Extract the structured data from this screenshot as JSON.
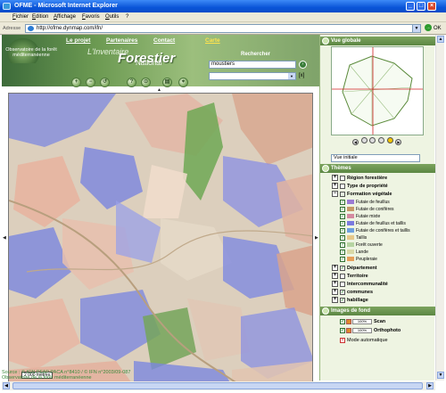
{
  "window": {
    "title": "OFME - Microsoft Internet Explorer"
  },
  "menu": [
    "Fichier",
    "Edition",
    "Affichage",
    "Favoris",
    "Outils",
    "?"
  ],
  "address": {
    "label": "Adresse",
    "url": "http://ofme.dynmap.com/ifn/",
    "go": "OK"
  },
  "site": {
    "logo_text": "Observatoire de la forêt méditerranéenne",
    "nav": [
      "Le projet",
      "Partenaires",
      "Contact",
      "Carte"
    ],
    "brand_small": "L'Inventaire",
    "brand_big": "Forestier",
    "brand_sub": "National",
    "search_label": "Rechercher",
    "search_value": "moustiers",
    "search_clear": "[x]"
  },
  "map": {
    "scale_text": "2 000   mètres",
    "source_line1": "Source : © IGN PFAP PACA n°8410 / © IFN n°2003/09-087",
    "source_line2": "Observatoire de la forêt méditerranéenne"
  },
  "panel": {
    "vue_globale": "Vue globale",
    "vue_select": "Vue initiale",
    "themes_title": "Thèmes",
    "themes": [
      "Région forestière",
      "Type de propriété",
      "Formation végétale"
    ],
    "formation": [
      {
        "label": "Futaie de feuillus",
        "color": "#9b7bd4"
      },
      {
        "label": "Futaie de conifères",
        "color": "#c79a6a"
      },
      {
        "label": "Futaie mixte",
        "color": "#d58aa0"
      },
      {
        "label": "Futaie de feuillus et taillis",
        "color": "#7a7adf"
      },
      {
        "label": "Futaie de conifères et taillis",
        "color": "#6ea0df"
      },
      {
        "label": "Taillis",
        "color": "#e6c88a"
      },
      {
        "label": "Forêt ouverte",
        "color": "#b6d4a2"
      },
      {
        "label": "Lande",
        "color": "#d9d9a6"
      },
      {
        "label": "Peupleraie",
        "color": "#e6a05a"
      }
    ],
    "themes_after": [
      "Département",
      "Territoire",
      "Intercommunalité",
      "communes",
      "habillage"
    ],
    "fond_title": "Images de fond",
    "fond": [
      {
        "label": "Scan",
        "opacity": "100%"
      },
      {
        "label": "Orthophoto",
        "opacity": "100%"
      }
    ],
    "auto": "Mode automatique"
  }
}
